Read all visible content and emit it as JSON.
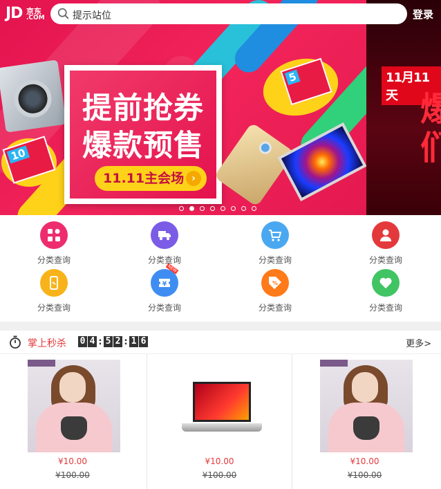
{
  "header": {
    "logo": {
      "jd": "JD",
      "cn": "京东",
      "com": ".COM"
    },
    "search_placeholder": "提示站位",
    "login_label": "登录"
  },
  "banner": {
    "headline_line1": "提前抢券",
    "headline_line2": "爆款预售",
    "cta_label": "11.11主会场",
    "coupon_top_value": "5",
    "coupon_bottom_value": "10",
    "next_slide_tag": "11月11天",
    "next_slide_chars": "爆\n们",
    "slide_count": 8,
    "active_slide": 2
  },
  "categories": [
    {
      "label": "分类查询",
      "icon": "grid-icon",
      "color": "#ee2d6e"
    },
    {
      "label": "分类查询",
      "icon": "truck-icon",
      "color": "#7b5ce6"
    },
    {
      "label": "分类查询",
      "icon": "cart-icon",
      "color": "#4aa8f0"
    },
    {
      "label": "分类查询",
      "icon": "user-icon",
      "color": "#e4393c"
    },
    {
      "label": "分类查询",
      "icon": "phone-icon",
      "color": "#f8b31a"
    },
    {
      "label": "分类查询",
      "icon": "ticket-icon",
      "color": "#3f8df2",
      "badge": "NEW"
    },
    {
      "label": "分类查询",
      "icon": "coupon-icon",
      "color": "#ff7a18"
    },
    {
      "label": "分类查询",
      "icon": "heart-icon",
      "color": "#41c463"
    }
  ],
  "seckill": {
    "title": "掌上秒杀",
    "timer": [
      "0",
      "4",
      "5",
      "2",
      "1",
      "6"
    ],
    "more_label": "更多>",
    "products": [
      {
        "price": "¥10.00",
        "old_price": "¥100.00",
        "image": "sweater"
      },
      {
        "price": "¥10.00",
        "old_price": "¥100.00",
        "image": "laptop"
      },
      {
        "price": "¥10.00",
        "old_price": "¥100.00",
        "image": "sweater"
      }
    ]
  },
  "colors": {
    "accent": "#e4393c",
    "banner": "#e8184f"
  }
}
